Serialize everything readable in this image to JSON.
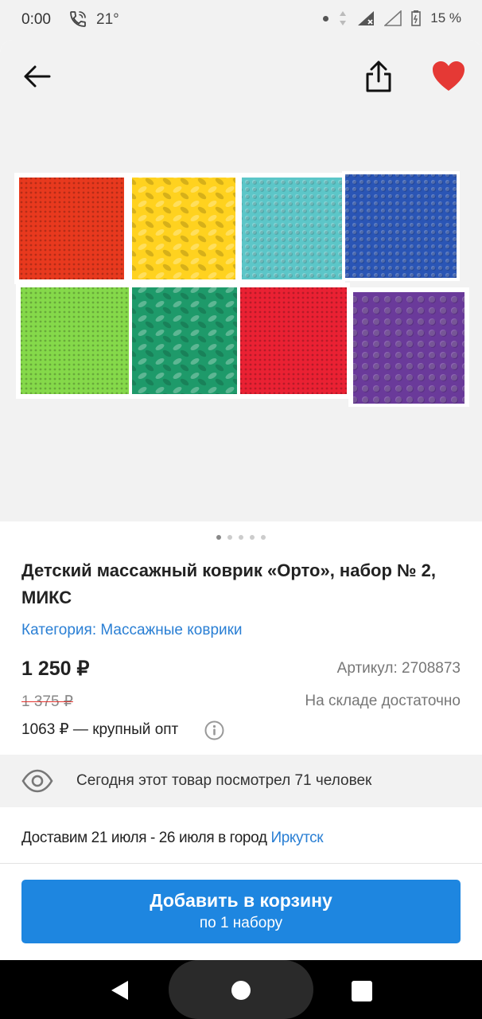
{
  "status_bar": {
    "time": "0:00",
    "temperature": "21°",
    "battery": "15 %"
  },
  "gallery": {
    "slide_count": 5,
    "active_slide": 1
  },
  "product": {
    "title": "Детский массажный коврик «Орто», набор № 2, МИКС",
    "category": "Категория: Массажные коврики",
    "price": "1 250 ₽",
    "article": "Артикул: 2708873",
    "old_price": "1 375 ₽",
    "stock": "На складе достаточно",
    "wholesale": "1063 ₽ — крупный опт"
  },
  "views": {
    "text": "Сегодня этот товар посмотрел 71 человек"
  },
  "delivery": {
    "prefix": "Доставим 21 июля - 26 июля в город",
    "city": "Иркутск"
  },
  "cart_button": {
    "label": "Добавить в корзину",
    "sublabel": "по 1 набору"
  },
  "colors": {
    "accent": "#1e86e0",
    "link": "#2a7fd4",
    "favorite": "#e53935"
  },
  "mats": {
    "top": [
      "#e8391e",
      "#ffd21f",
      "#5cc6c8",
      "#2a55b5"
    ],
    "bottom": [
      "#85d94a",
      "#1e9a6a",
      "#ea2133",
      "#6a3a9a"
    ]
  }
}
